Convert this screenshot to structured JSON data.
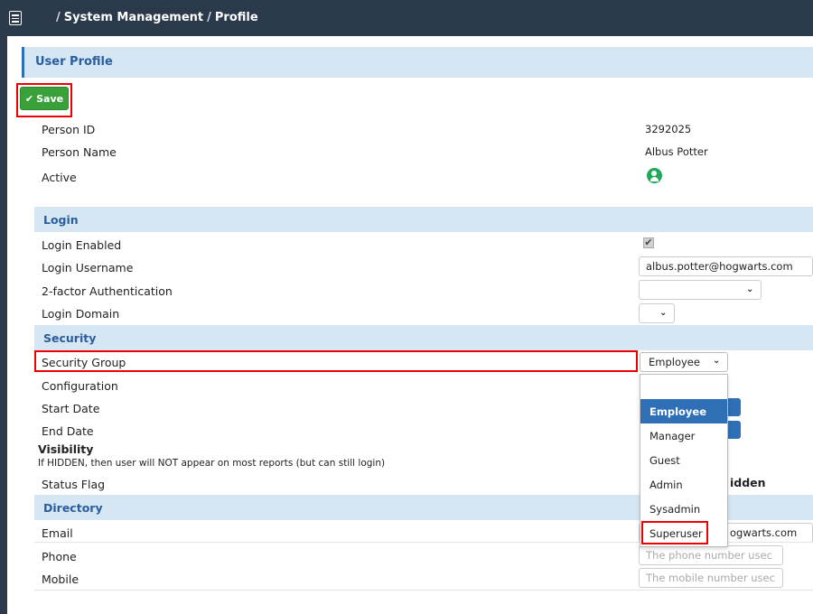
{
  "breadcrumb": {
    "sep1": "/",
    "section": "System Management",
    "sep2": "/",
    "current": "Profile"
  },
  "panel_title": "User Profile",
  "save_label": "Save",
  "profile": {
    "person_id_label": "Person ID",
    "person_id": "3292025",
    "person_name_label": "Person Name",
    "person_name": "Albus Potter",
    "active_label": "Active"
  },
  "login": {
    "title": "Login",
    "enabled_label": "Login Enabled",
    "enabled_checked": true,
    "username_label": "Login Username",
    "username": "albus.potter@hogwarts.com",
    "twofa_label": "2-factor Authentication",
    "twofa_value": "",
    "domain_label": "Login Domain",
    "domain_value": ""
  },
  "security": {
    "title": "Security",
    "group_label": "Security Group",
    "group_value": "Employee",
    "config_label": "Configuration",
    "start_label": "Start Date",
    "end_label": "End Date",
    "visibility_label": "Visibility",
    "visibility_note": "If HIDDEN, then user will NOT appear on most reports (but can still login)",
    "status_label": "Status Flag",
    "status_value": "idden",
    "group_options": [
      "",
      "Employee",
      "Manager",
      "Guest",
      "Admin",
      "Sysadmin",
      "Superuser"
    ]
  },
  "directory": {
    "title": "Directory",
    "email_label": "Email",
    "email_value": "ogwarts.com",
    "phone_label": "Phone",
    "phone_placeholder": "The phone number usec",
    "mobile_label": "Mobile",
    "mobile_placeholder": "The mobile number usec"
  }
}
